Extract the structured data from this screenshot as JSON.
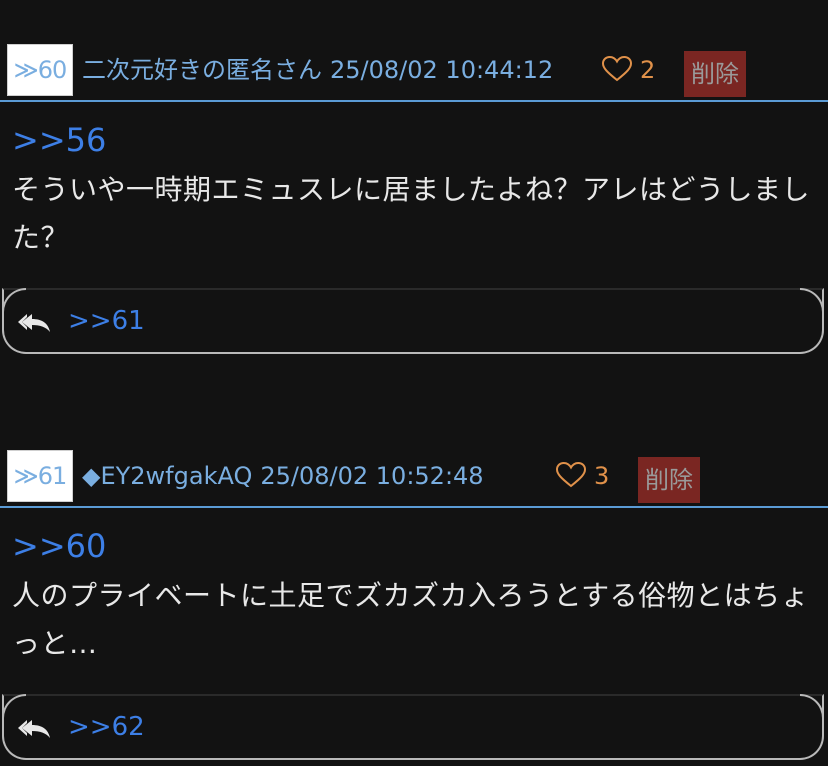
{
  "posts": [
    {
      "number_label": "≫60",
      "author": "二次元好きの匿名さん",
      "date": "25/08/02 10:44:12",
      "like_count": "2",
      "delete_label": "削除",
      "reply_to": ">>56",
      "body": "そういや一時期エミュスレに居ましたよね？アレはどうしました？",
      "next_reply": ">>61"
    },
    {
      "number_label": "≫61",
      "author": "◆EY2wfgakAQ",
      "date": "25/08/02 10:52:48",
      "like_count": "3",
      "delete_label": "削除",
      "reply_to": ">>60",
      "body": "人のプライベートに土足でズカズカ入ろうとする俗物とはちょっと…",
      "next_reply": ">>62"
    }
  ],
  "colors": {
    "background": "#121212",
    "link_blue": "#3d7fe6",
    "meta_blue": "#7aaee0",
    "like_orange": "#e0914a",
    "delete_bg": "#7a2622",
    "divider": "#5b9bd5"
  },
  "icons": {
    "like": "heart-outline-icon",
    "reply": "reply-all-arrow-icon"
  }
}
